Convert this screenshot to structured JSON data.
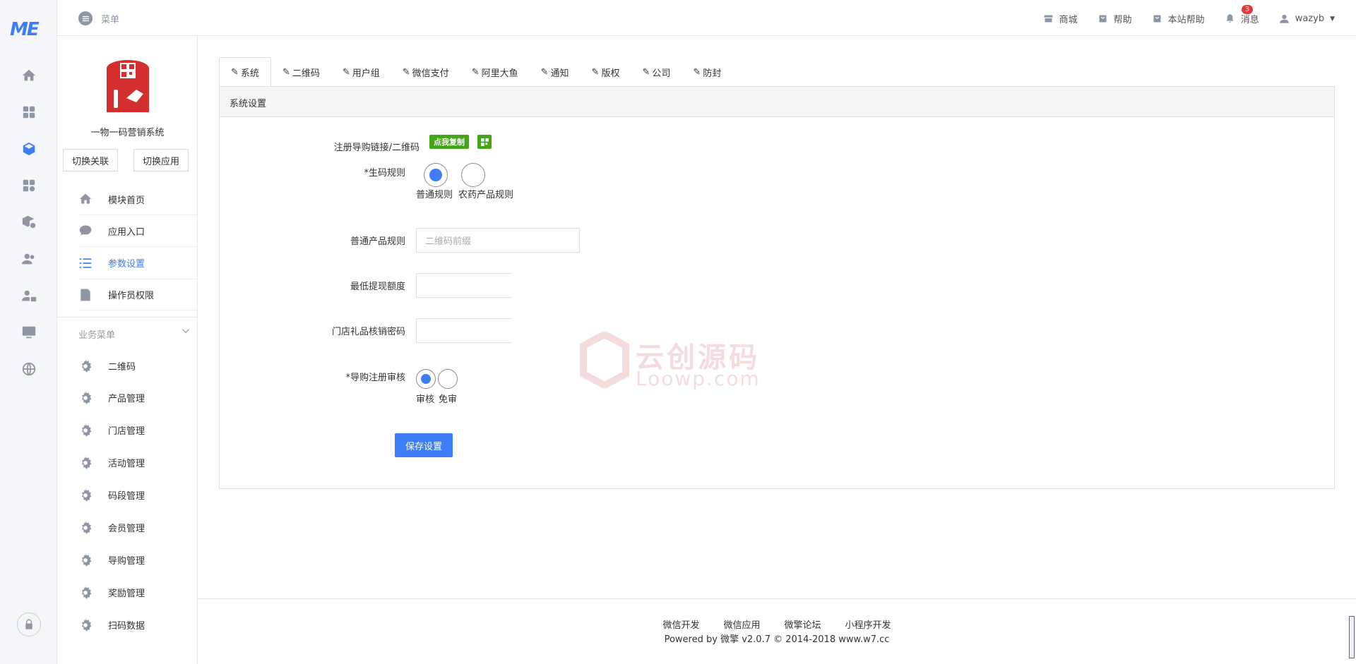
{
  "brand": {
    "logo_text": "ME",
    "accent": "#3d7df5"
  },
  "rail": {
    "icons": [
      "home-icon",
      "grid-icon",
      "cube-icon",
      "apps-settings-icon",
      "box-settings-icon",
      "users-icon",
      "user-lock-icon",
      "monitor-icon",
      "globe-icon"
    ],
    "active": "cube-icon",
    "bottom": "lock-icon"
  },
  "topbar": {
    "menu_label": "菜单",
    "links": [
      {
        "label": "商城",
        "icon": "store-icon"
      },
      {
        "label": "帮助",
        "icon": "bag-icon"
      },
      {
        "label": "本站帮助",
        "icon": "bag-icon"
      },
      {
        "label": "消息",
        "icon": "bell-icon",
        "badge": "3"
      }
    ],
    "user": "wazyb"
  },
  "sidebar": {
    "app_name": "一物一码营销系统",
    "switch_buttons": [
      "切换关联",
      "切换应用"
    ],
    "items": [
      {
        "label": "模块首页",
        "icon": "home-icon"
      },
      {
        "label": "应用入口",
        "icon": "chat-icon"
      },
      {
        "label": "参数设置",
        "icon": "list-icon",
        "active": true
      },
      {
        "label": "操作员权限",
        "icon": "edit-doc-icon"
      }
    ],
    "biz_menu_title": "业务菜单",
    "biz_items": [
      "二维码",
      "产品管理",
      "门店管理",
      "活动管理",
      "码段管理",
      "会员管理",
      "导购管理",
      "奖励管理",
      "扫码数据"
    ]
  },
  "tabs": [
    "系统",
    "二维码",
    "用户组",
    "微信支付",
    "阿里大鱼",
    "通知",
    "版权",
    "公司",
    "防封"
  ],
  "panel": {
    "title": "系统设置",
    "register_link_label": "注册导购链接/二维码",
    "copy_button": "点我复制",
    "code_rule_label": "*生码规则",
    "code_rule_options": [
      "普通规则",
      "农药产品规则"
    ],
    "normal_rule_label": "普通产品规则",
    "normal_rule_placeholder": "二维码前缀",
    "min_withdraw_label": "最低提现额度",
    "min_withdraw_value": "",
    "store_pwd_label": "门店礼品核销密码",
    "store_pwd_value": "",
    "guide_review_label": "*导购注册审核",
    "guide_review_options": [
      "审核",
      "免审"
    ],
    "save_button": "保存设置"
  },
  "watermark": {
    "cn": "云创源码",
    "en": "Loowp.com"
  },
  "footer": {
    "links": [
      "微信开发",
      "微信应用",
      "微擎论坛",
      "小程序开发"
    ],
    "copyright": "Powered by 微擎 v2.0.7 © 2014-2018 www.w7.cc"
  }
}
